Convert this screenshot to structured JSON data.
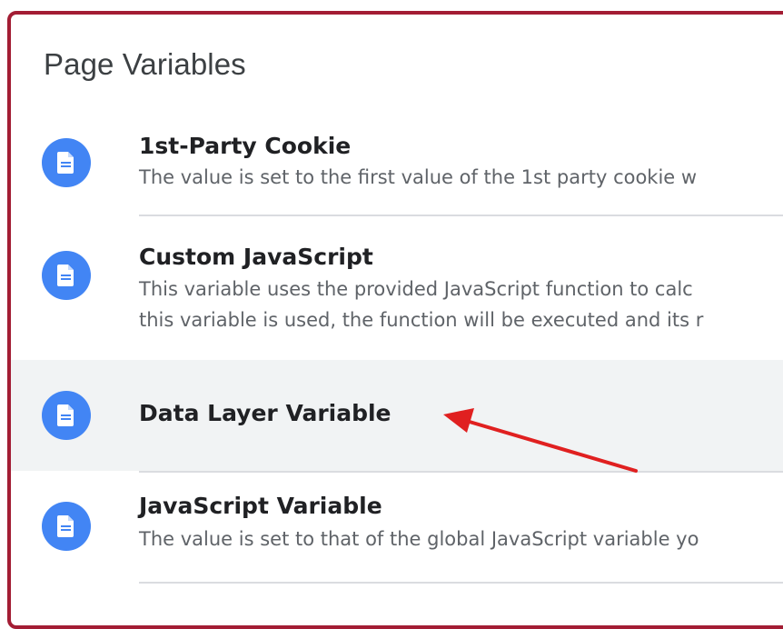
{
  "section": {
    "title": "Page Variables"
  },
  "items": [
    {
      "name": "1st-Party Cookie",
      "desc_line1": "The value is set to the first value of the 1st party cookie w",
      "desc_line2": "",
      "icon": "document-icon"
    },
    {
      "name": "Custom JavaScript",
      "desc_line1": "This variable uses the provided JavaScript function to calc",
      "desc_line2": "this variable is used, the function will be executed and its r",
      "icon": "document-icon"
    },
    {
      "name": "Data Layer Variable",
      "desc_line1": "",
      "desc_line2": "",
      "icon": "document-icon"
    },
    {
      "name": "JavaScript Variable",
      "desc_line1": "The value is set to that of the global JavaScript variable yo",
      "desc_line2": "",
      "icon": "document-icon"
    }
  ],
  "colors": {
    "frame_border": "#a31d34",
    "icon_bg": "#4285f4",
    "highlight_bg": "#f1f3f4",
    "arrow": "#e02020"
  }
}
